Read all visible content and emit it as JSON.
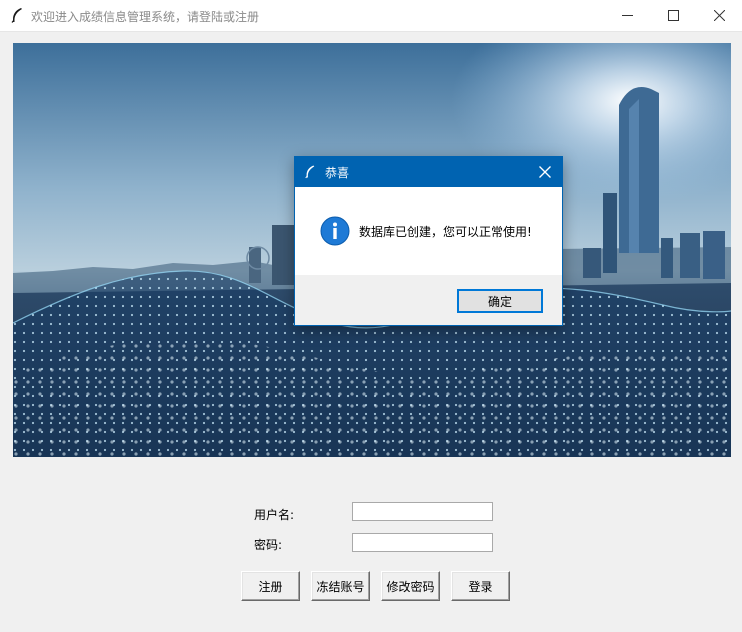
{
  "window": {
    "title": "欢迎进入成绩信息管理系统，请登陆或注册",
    "icon": "feather-icon"
  },
  "form": {
    "username_label": "用户名:",
    "username_value": "",
    "password_label": "密码:",
    "password_value": ""
  },
  "buttons": {
    "register": "注册",
    "freeze": "冻结账号",
    "change_password": "修改密码",
    "login": "登录"
  },
  "dialog": {
    "title": "恭喜",
    "message": "数据库已创建，您可以正常使用!",
    "ok_label": "确定",
    "icon": "info-icon"
  },
  "colors": {
    "dialog_title_bar": "#0063b1",
    "ok_border": "#0078d7",
    "window_bg": "#f0f0f0"
  }
}
